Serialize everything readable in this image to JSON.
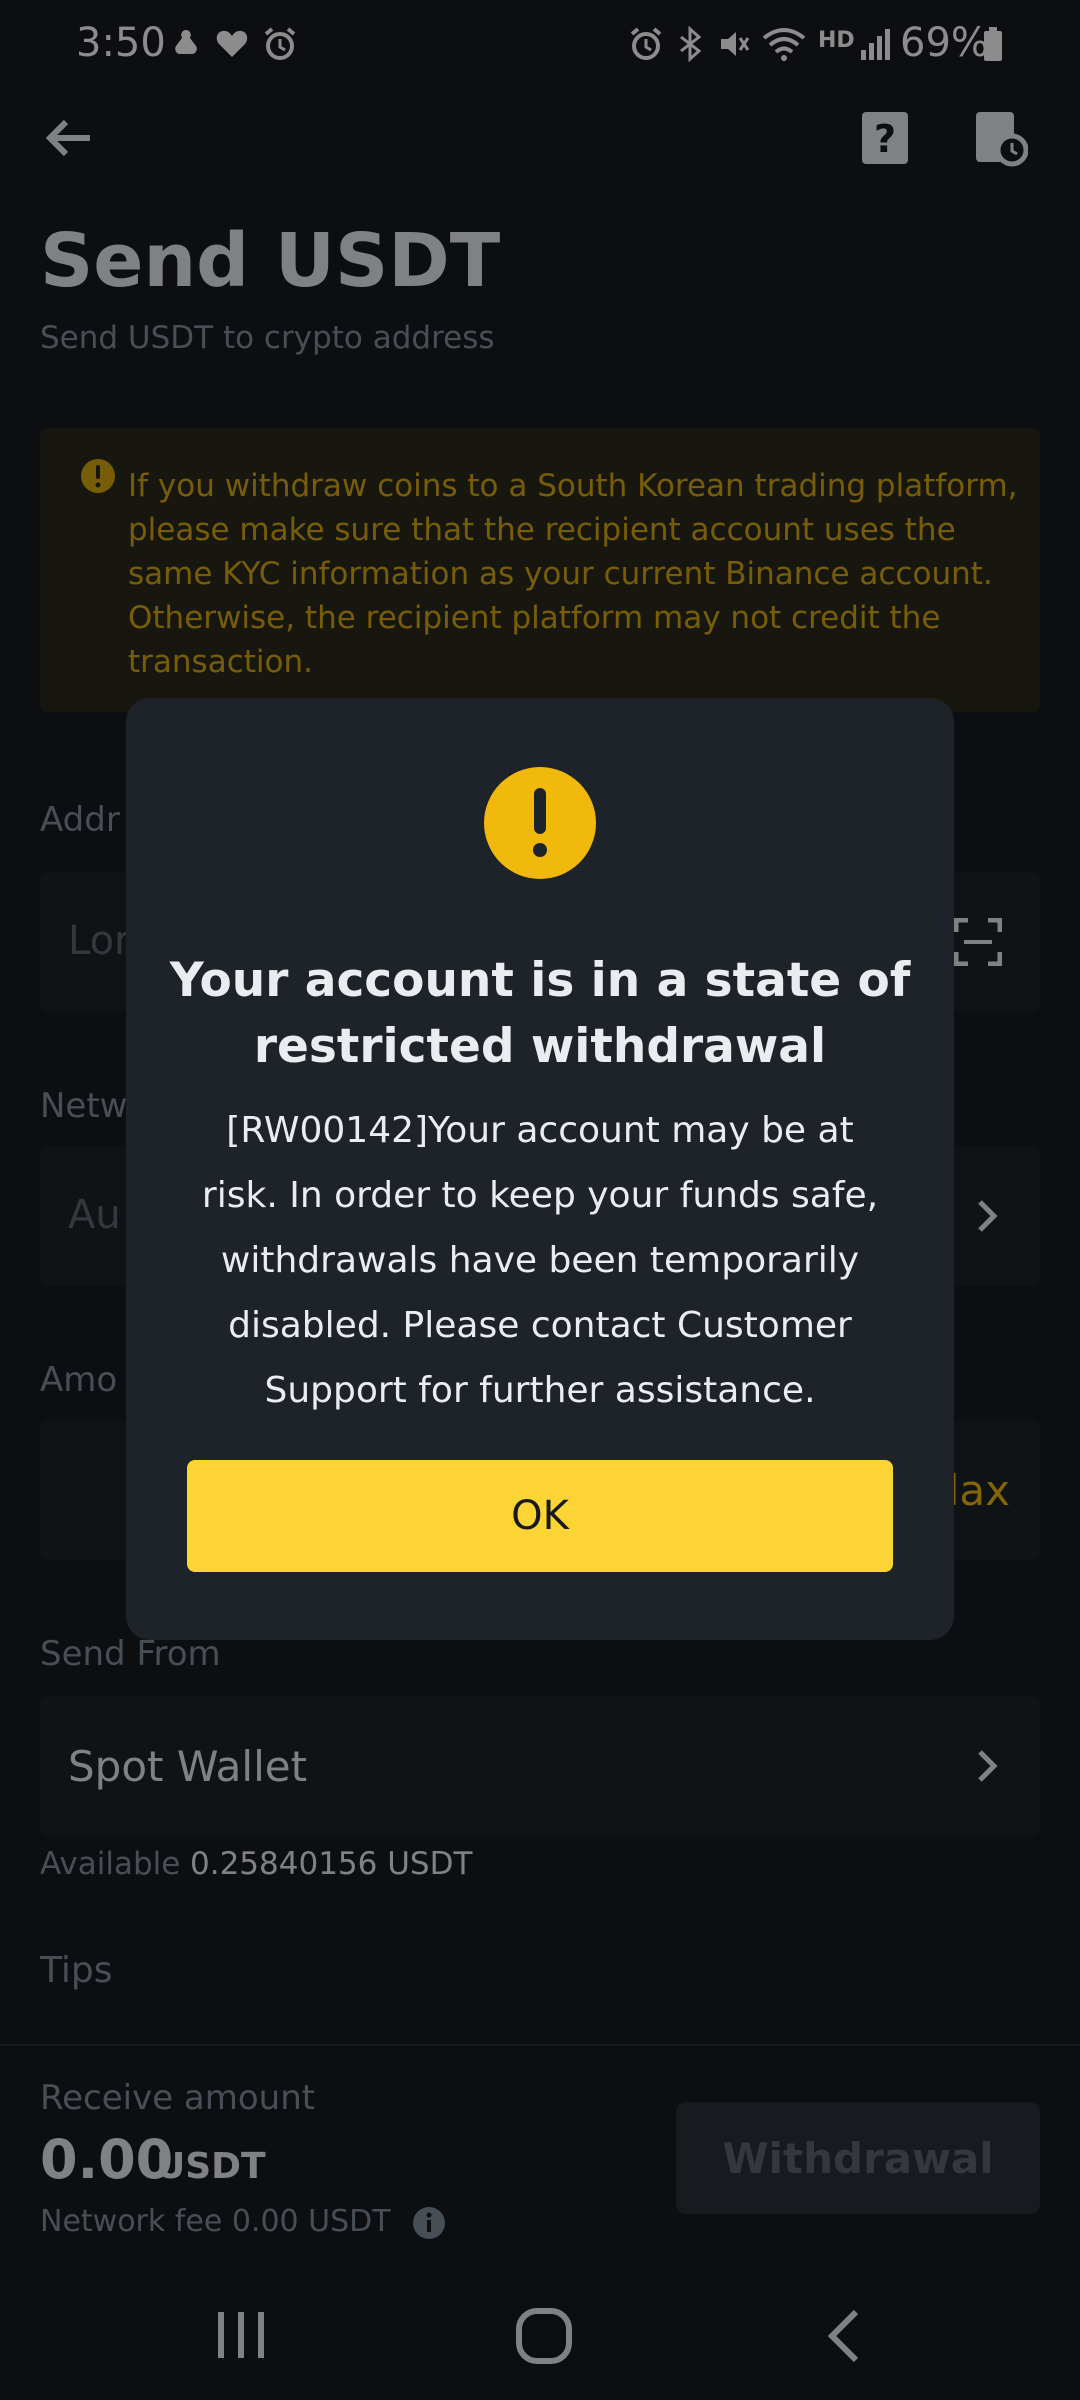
{
  "status_bar": {
    "time": "3:50",
    "battery": "69%",
    "icons": [
      "notification-icon",
      "heart-icon",
      "alarm-icon",
      "alarm-icon",
      "bluetooth-icon",
      "mute-icon",
      "wifi-icon",
      "hd-voice-icon",
      "signal-icon",
      "battery-icon"
    ],
    "hd_voice": "HD"
  },
  "header": {
    "title": "Send USDT",
    "subtitle": "Send USDT to crypto address"
  },
  "notice": {
    "text": "If you withdraw coins to a South Korean trading platform, please make sure that the recipient account uses the same KYC information as your current Binance account. Otherwise, the recipient platform may not credit the transaction."
  },
  "form": {
    "address_label": "Addr",
    "address_placeholder": "Lor",
    "network_label": "Netw",
    "network_placeholder": "Au",
    "amount_label": "Amo",
    "max_label": "lax",
    "send_from_label": "Send From",
    "send_from_value": "Spot Wallet",
    "available_label": "Available",
    "available_value": "0.25840156 USDT",
    "tips_label": "Tips"
  },
  "footer": {
    "receive_label": "Receive amount",
    "receive_amount": "0.00",
    "receive_unit": "USDT",
    "fee_label": "Network fee",
    "fee_value": "0.00 USDT",
    "withdraw_button": "Withdrawal"
  },
  "dialog": {
    "title": "Your account is in a state of restricted withdrawal",
    "body": "[RW00142]Your account may be at risk. In order to keep your funds safe, withdrawals have been temporarily disabled. Please contact Customer Support for further assistance.",
    "ok_button": "OK"
  },
  "colors": {
    "background": "#181a20",
    "accent": "#fcd535",
    "warning_text": "#d9a90e",
    "dialog_background": "#1e2329"
  }
}
